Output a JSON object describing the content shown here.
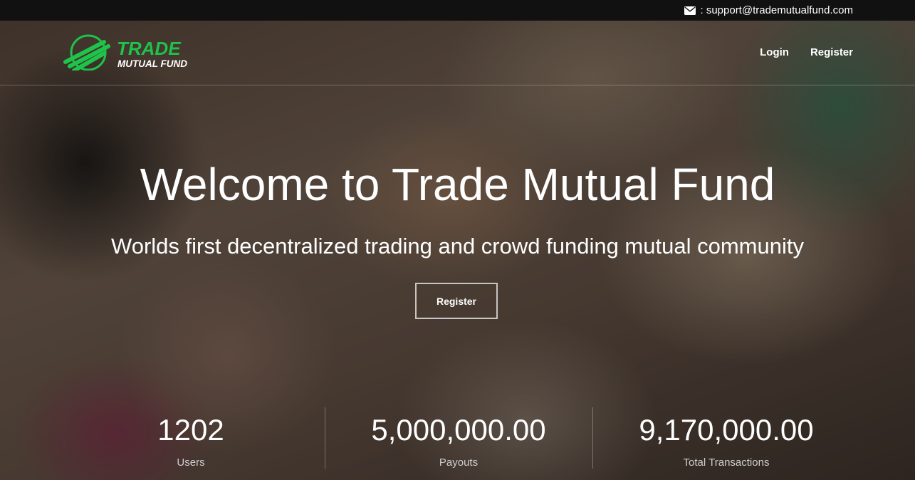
{
  "topbar": {
    "email": ": support@trademutualfund.com",
    "icon": "envelope-icon"
  },
  "brand": {
    "line1": "TRADE",
    "line2": "MUTUAL FUND",
    "accent_color": "#1fc24a"
  },
  "nav": {
    "login": "Login",
    "register": "Register"
  },
  "hero": {
    "title": "Welcome to Trade Mutual Fund",
    "subtitle": "Worlds first decentralized trading and crowd funding mutual community",
    "cta": "Register"
  },
  "stats": [
    {
      "value": "1202",
      "label": "Users"
    },
    {
      "value": "5,000,000.00",
      "label": "Payouts"
    },
    {
      "value": "9,170,000.00",
      "label": "Total Transactions"
    }
  ]
}
